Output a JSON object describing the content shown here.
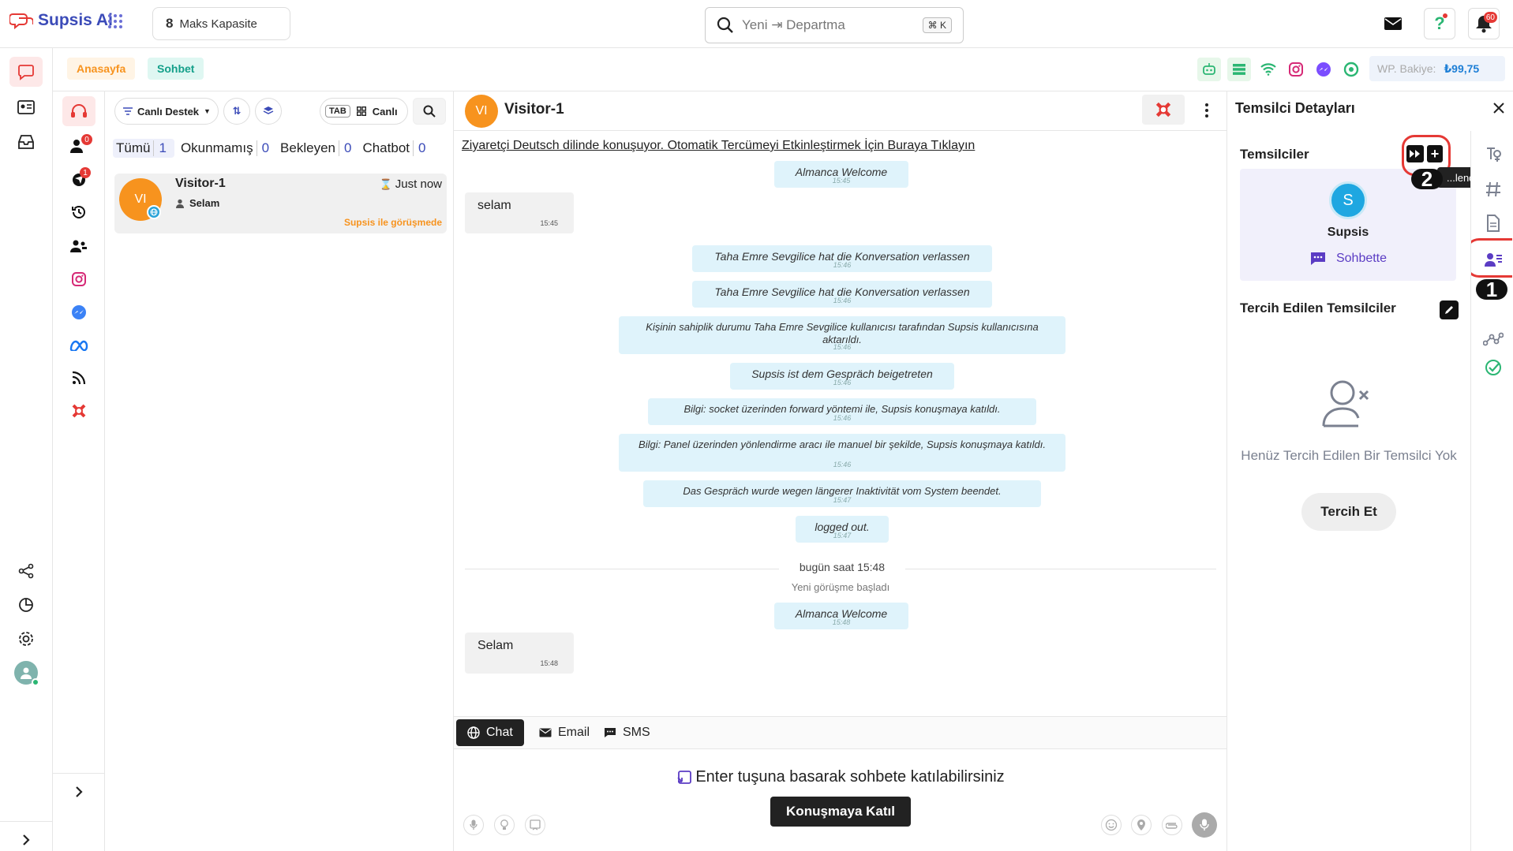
{
  "topbar": {
    "brand": "Supsis Ai",
    "capacity_number": "8",
    "capacity_label": "Maks Kapasite",
    "search_placeholder": "Yeni ⇥ Departma",
    "search_shortcut": "⌘ K",
    "notification_count": "60"
  },
  "breadcrumb": {
    "home": "Anasayfa",
    "current": "Sohbet"
  },
  "wp_balance": {
    "label": "WP. Bakiye:",
    "value": "₺99,75"
  },
  "rail_badges": {
    "agents": "0",
    "inbox": "1"
  },
  "list_toolbar": {
    "filter": "Canlı Destek",
    "tab_key": "TAB",
    "view": "Canlı"
  },
  "tabs": [
    {
      "label": "Tümü",
      "count": "1"
    },
    {
      "label": "Okunmamış",
      "count": "0"
    },
    {
      "label": "Bekleyen",
      "count": "0"
    },
    {
      "label": "Chatbot",
      "count": "0"
    }
  ],
  "conversation": {
    "avatar": "VI",
    "name": "Visitor-1",
    "time": "Just now",
    "preview": "Selam",
    "status": "Supsis ile görüşmede"
  },
  "chat": {
    "avatar": "VI",
    "title": "Visitor-1",
    "notice": "Ziyaretçi Deutsch dilinde konuşuyor. Otomatik Tercümeyi Etkinleştirmek İçin Buraya Tıklayın",
    "messages": [
      {
        "kind": "sys",
        "text": "Almanca Welcome",
        "ts": "15:45"
      },
      {
        "kind": "visitor",
        "text": "selam",
        "ts": "15:45"
      },
      {
        "kind": "sys",
        "text": "Taha Emre Sevgilice hat die Konversation verlassen",
        "ts": "15:46"
      },
      {
        "kind": "sys",
        "text": "Taha Emre Sevgilice hat die Konversation verlassen",
        "ts": "15:46"
      },
      {
        "kind": "sys",
        "text": "Kişinin sahiplik durumu Taha Emre Sevgilice kullanıcısı tarafından Supsis kullanıcısına aktarıldı.",
        "ts": "15:46"
      },
      {
        "kind": "sys",
        "text": "Supsis ist dem Gespräch beigetreten",
        "ts": "15:46"
      },
      {
        "kind": "sys",
        "text": "Bilgi: socket üzerinden forward yöntemi ile, Supsis konuşmaya katıldı.",
        "ts": "15:46"
      },
      {
        "kind": "sys",
        "text": "Bilgi: Panel üzerinden yönlendirme aracı ile manuel bir şekilde, Supsis konuşmaya katıldı.",
        "ts": "15:46"
      },
      {
        "kind": "sys",
        "text": "Das Gespräch wurde wegen längerer Inaktivität vom System beendet.",
        "ts": "15:47"
      },
      {
        "kind": "sys",
        "text": "logged out.",
        "ts": "15:47"
      },
      {
        "kind": "divider",
        "text": "bugün saat 15:48",
        "sub": "Yeni görüşme başladı"
      },
      {
        "kind": "sys",
        "text": "Almanca Welcome",
        "ts": "15:48"
      },
      {
        "kind": "visitor",
        "text": "Selam",
        "ts": "15:48"
      }
    ],
    "channels": [
      "Chat",
      "Email",
      "SMS"
    ],
    "join_hint": "Enter tuşuna basarak sohbete katılabilirsiniz",
    "join_button": "Konuşmaya Katıl"
  },
  "right_panel": {
    "title": "Temsilci Detayları",
    "agents_header": "Temsilciler",
    "tooltip": "...lendir",
    "agent_initial": "S",
    "agent_name": "Supsis",
    "agent_status": "Sohbette",
    "preferred_header": "Tercih Edilen Temsilciler",
    "empty_text": "Henüz Tercih Edilen Bir Temsilci Yok",
    "prefer_button": "Tercih Et",
    "marker_1": "1",
    "marker_2": "2"
  },
  "colors": {
    "brand": "#3b4bb8",
    "accent_orange": "#f7931e",
    "sys_bg": "#dff3fb",
    "red": "#e53935",
    "purple": "#5b3cc4"
  }
}
